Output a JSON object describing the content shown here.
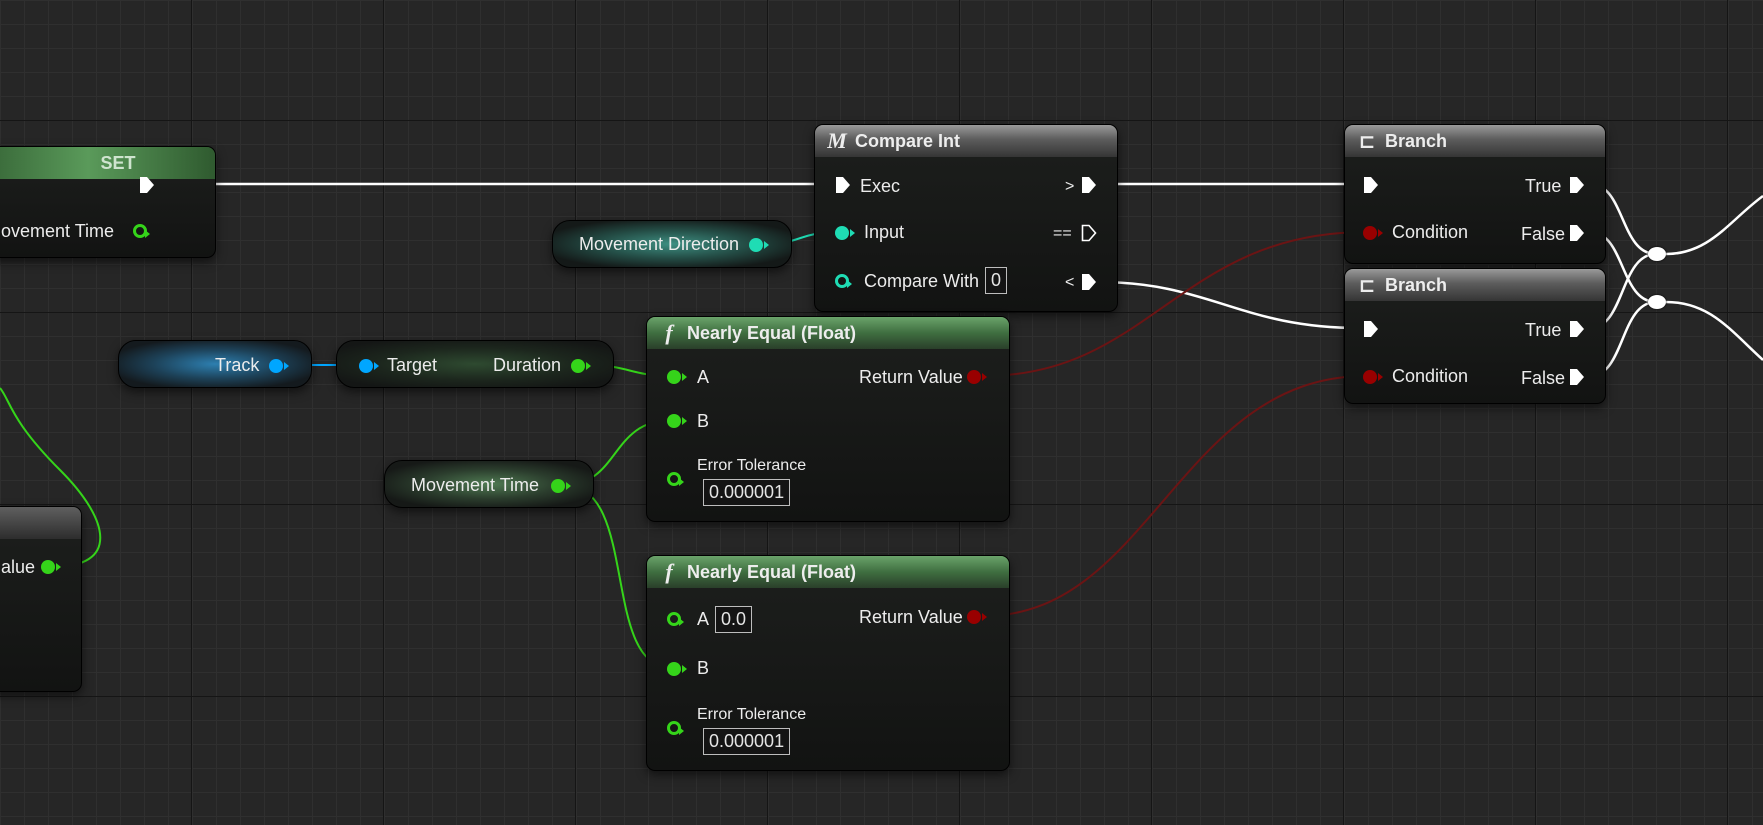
{
  "set_node": {
    "title": "SET",
    "var_label": "ovement Time"
  },
  "partial_node": {
    "pin_label": "alue"
  },
  "get_movement_direction": {
    "label": "Movement Direction"
  },
  "get_track": {
    "label": "Track"
  },
  "duration_node": {
    "target_label": "Target",
    "output_label": "Duration"
  },
  "get_movement_time": {
    "label": "Movement Time"
  },
  "compare_int": {
    "icon": "M",
    "title": "Compare Int",
    "exec_label": "Exec",
    "input_label": "Input",
    "compare_with_label": "Compare With",
    "compare_with_value": "0",
    "gt_label": ">",
    "eq_label": "==",
    "lt_label": "<"
  },
  "nearly_equal_1": {
    "icon": "f",
    "title": "Nearly Equal (Float)",
    "a_label": "A",
    "b_label": "B",
    "tolerance_label": "Error Tolerance",
    "tolerance_value": "0.000001",
    "return_label": "Return Value"
  },
  "nearly_equal_2": {
    "icon": "f",
    "title": "Nearly Equal (Float)",
    "a_label": "A",
    "a_value": "0.0",
    "b_label": "B",
    "tolerance_label": "Error Tolerance",
    "tolerance_value": "0.000001",
    "return_label": "Return Value"
  },
  "branch_1": {
    "title": "Branch",
    "condition_label": "Condition",
    "true_label": "True",
    "false_label": "False"
  },
  "branch_2": {
    "title": "Branch",
    "condition_label": "Condition",
    "true_label": "True",
    "false_label": "False"
  },
  "colors": {
    "exec": "#ffffff",
    "float": "#35d41a",
    "int": "#1fdcb4",
    "bool": "#990000",
    "object": "#00a6ff",
    "wire_bool": "#6b1414"
  }
}
